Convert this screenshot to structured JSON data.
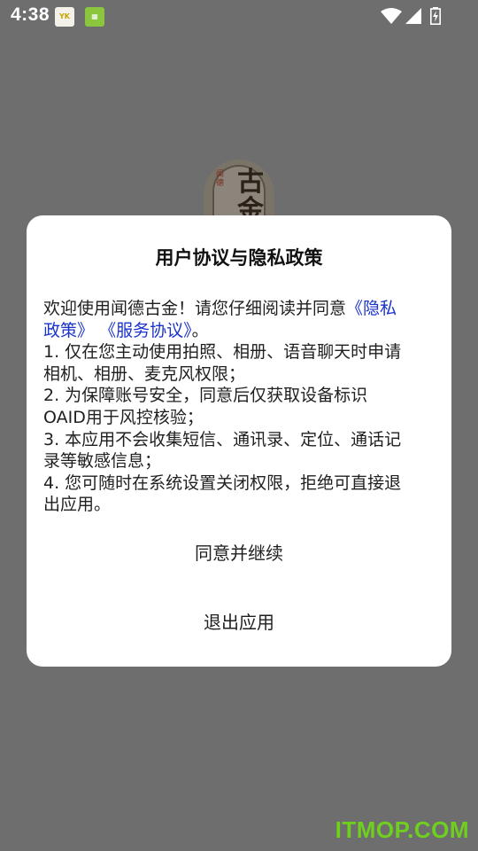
{
  "status_bar": {
    "time": "4:38",
    "notification_icons": [
      "app-notification-icon",
      "app-notification-icon"
    ],
    "icons": [
      "wifi-icon",
      "cell-signal-icon",
      "battery-charging-icon"
    ]
  },
  "background": {
    "logo_text": "古金",
    "logo_side_text": "闻德"
  },
  "dialog": {
    "title": "用户协议与隐私政策",
    "intro_text": "欢迎使用闻德古金！请您仔细阅读并同意",
    "privacy_link_part1": "《隐私",
    "privacy_link_part2": "政策》",
    "service_link": "《服务协议》",
    "intro_end": "。",
    "lines": [
      "1. 仅在您主动使用拍照、相册、语音聊天时申请",
      "相机、相册、麦克风权限；",
      "2. 为保障账号安全，同意后仅获取设备标识",
      "OAID用于风控核验；",
      "3. 本应用不会收集短信、通讯录、定位、通话记",
      "录等敏感信息；",
      "4. 您可随时在系统设置关闭权限，拒绝可直接退",
      "出应用。"
    ],
    "agree_label": "同意并继续",
    "exit_label": "退出应用"
  },
  "watermark": "ITMOP.COM",
  "colors": {
    "scrim": "#6e6e6e",
    "dialog_bg": "#ffffff",
    "link": "#1a33cc",
    "watermark": "#6fcf1e"
  }
}
